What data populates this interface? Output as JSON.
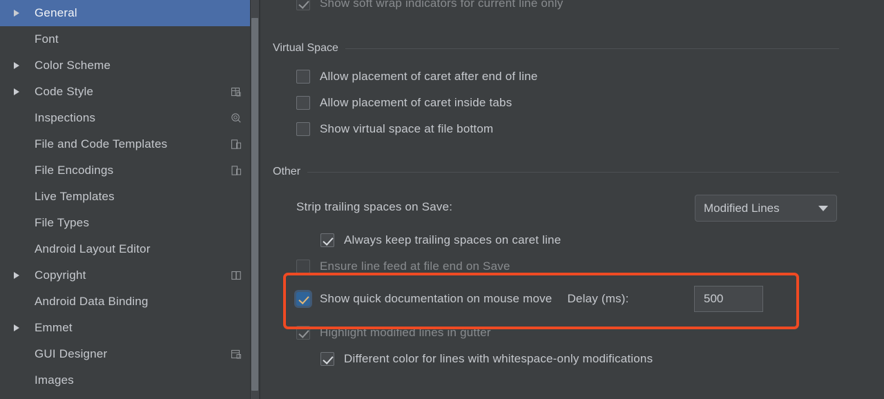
{
  "sidebar": {
    "items": [
      {
        "label": "General",
        "expandable": true,
        "selected": true,
        "icon": null
      },
      {
        "label": "Font",
        "expandable": false,
        "selected": false,
        "icon": null
      },
      {
        "label": "Color Scheme",
        "expandable": true,
        "selected": false,
        "icon": null
      },
      {
        "label": "Code Style",
        "expandable": true,
        "selected": false,
        "icon": "module-config-icon"
      },
      {
        "label": "Inspections",
        "expandable": false,
        "selected": false,
        "icon": "module-config-icon"
      },
      {
        "label": "File and Code Templates",
        "expandable": false,
        "selected": false,
        "icon": "module-config-icon"
      },
      {
        "label": "File Encodings",
        "expandable": false,
        "selected": false,
        "icon": "module-config-icon"
      },
      {
        "label": "Live Templates",
        "expandable": false,
        "selected": false,
        "icon": null
      },
      {
        "label": "File Types",
        "expandable": false,
        "selected": false,
        "icon": null
      },
      {
        "label": "Android Layout Editor",
        "expandable": false,
        "selected": false,
        "icon": null
      },
      {
        "label": "Copyright",
        "expandable": true,
        "selected": false,
        "icon": "module-config-icon"
      },
      {
        "label": "Android Data Binding",
        "expandable": false,
        "selected": false,
        "icon": null
      },
      {
        "label": "Emmet",
        "expandable": true,
        "selected": false,
        "icon": null
      },
      {
        "label": "GUI Designer",
        "expandable": false,
        "selected": false,
        "icon": "module-config-icon"
      },
      {
        "label": "Images",
        "expandable": false,
        "selected": false,
        "icon": null
      }
    ]
  },
  "content": {
    "soft_wrap_row": {
      "label": "Show soft wrap indicators for current line only",
      "checked": true
    },
    "virtual_space": {
      "title": "Virtual Space",
      "options": [
        {
          "label": "Allow placement of caret after end of line",
          "checked": false
        },
        {
          "label": "Allow placement of caret inside tabs",
          "checked": false
        },
        {
          "label": "Show virtual space at file bottom",
          "checked": false
        }
      ]
    },
    "other": {
      "title": "Other",
      "strip_trailing_label": "Strip trailing spaces on Save:",
      "strip_trailing_value": "Modified Lines",
      "always_keep": {
        "label": "Always keep trailing spaces on caret line",
        "checked": true
      },
      "ensure_line_feed": {
        "label": "Ensure line feed at file end on Save",
        "checked": false
      },
      "quick_doc": {
        "label": "Show quick documentation on mouse move",
        "checked": true,
        "delay_label": "Delay (ms):",
        "delay_value": "500"
      },
      "highlight_modified": {
        "label": "Highlight modified lines in gutter",
        "checked": true
      },
      "different_color": {
        "label": "Different color for lines with whitespace-only modifications",
        "checked": true
      }
    }
  },
  "colors": {
    "selection_blue": "#4a6da7",
    "annotation_red": "#ef4a23",
    "accent_checkbox_blue": "#2f6499",
    "accent_check_tan": "#e3b878",
    "panel_bg": "#3c3f41",
    "text": "#c6c9ce"
  }
}
